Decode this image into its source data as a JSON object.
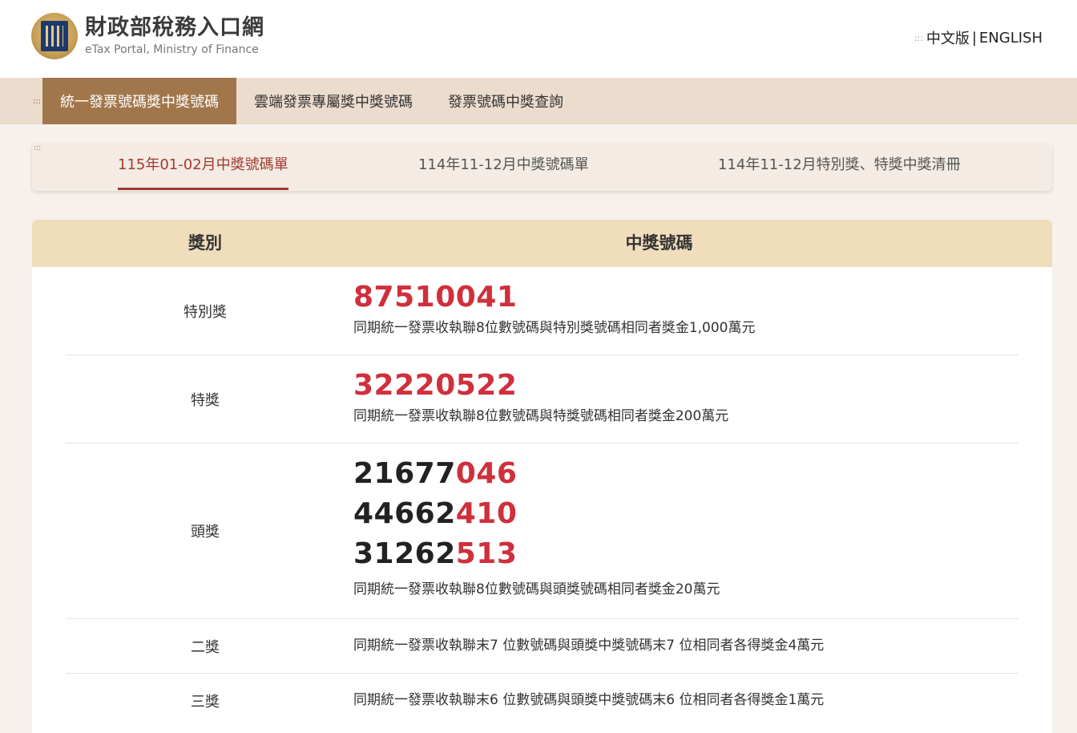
{
  "header": {
    "logo_cn": "財政部稅務入口網",
    "logo_en": "eTax Portal, Ministry of Finance",
    "lang_key": ":::",
    "lang_zh": "中文版",
    "lang_sep": "|",
    "lang_en": "ENGLISH"
  },
  "mainnav": {
    "access_key": ":::",
    "items": [
      {
        "label": "統一發票號碼獎中獎號碼"
      },
      {
        "label": "雲端發票專屬獎中獎號碼"
      },
      {
        "label": "發票號碼中獎查詢"
      }
    ]
  },
  "subtabs": {
    "access_key": ":::",
    "items": [
      {
        "label": "115年01-02月中獎號碼單"
      },
      {
        "label": "114年11-12月中獎號碼單"
      },
      {
        "label": "114年11-12月特別獎、特獎中獎清冊"
      }
    ]
  },
  "table": {
    "headers": [
      "獎別",
      "中獎號碼"
    ],
    "rows": [
      {
        "prize": "特別獎",
        "numbers": [
          "87510041"
        ],
        "desc": "同期統一發票收執聯8位數號碼與特別獎號碼相同者獎金1,000萬元"
      },
      {
        "prize": "特獎",
        "numbers": [
          "32220522"
        ],
        "desc": "同期統一發票收執聯8位數號碼與特獎號碼相同者獎金200萬元"
      },
      {
        "prize": "頭獎",
        "numbers": [
          {
            "head": "21677",
            "tail": "046"
          },
          {
            "head": "44662",
            "tail": "410"
          },
          {
            "head": "31262",
            "tail": "513"
          }
        ],
        "desc": "同期統一發票收執聯8位數號碼與頭獎號碼相同者獎金20萬元"
      },
      {
        "prize": "二獎",
        "desc": "同期統一發票收執聯末7 位數號碼與頭獎中獎號碼末7 位相同者各得獎金4萬元"
      },
      {
        "prize": "三獎",
        "desc": "同期統一發票收執聯末6 位數號碼與頭獎中獎號碼末6 位相同者各得獎金1萬元"
      }
    ]
  },
  "colors": {
    "nav_active": "#a1764a",
    "nav_bg": "#ebdcce",
    "table_header": "#f0ddbc",
    "winning_red": "#d02f3c",
    "tab_active": "#a33a2f"
  }
}
